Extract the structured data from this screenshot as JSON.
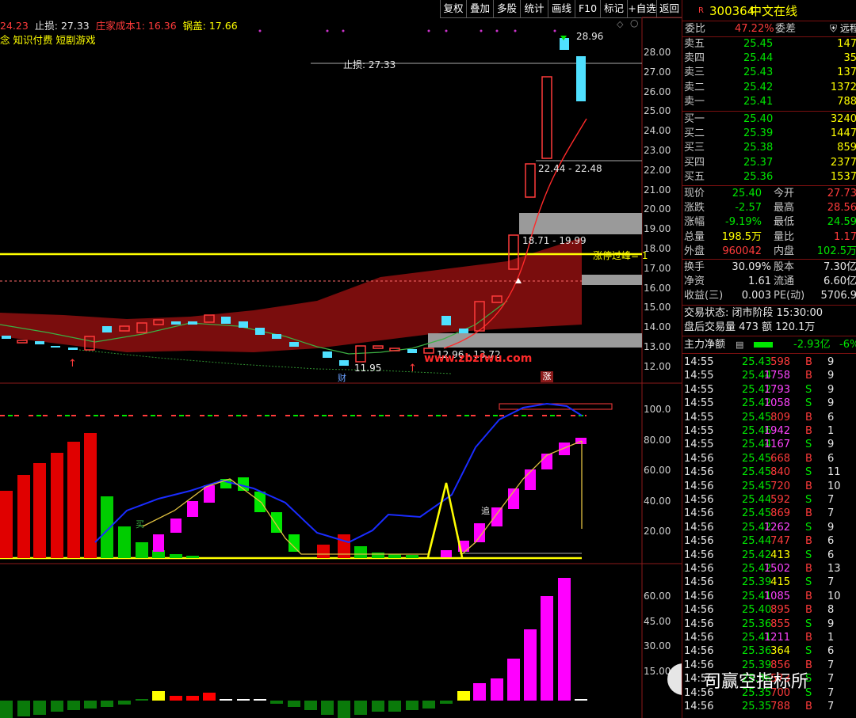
{
  "toolbar": {
    "buttons": [
      "复权",
      "叠加",
      "多股",
      "统计",
      "画线",
      "F10",
      "标记",
      "+自选",
      "返回"
    ]
  },
  "header": {
    "price_prefix": "24.23",
    "stop_loss": "止损: 27.33",
    "cost": "庄家成本1: 16.36",
    "lid": "锅盖: 17.66",
    "concepts": "念 知识付费 短剧游戏"
  },
  "y_axis": [
    "28.00",
    "27.00",
    "26.00",
    "25.00",
    "24.00",
    "23.00",
    "22.00",
    "21.00",
    "20.00",
    "19.00",
    "18.00",
    "17.00",
    "16.00",
    "15.00",
    "14.00",
    "13.00",
    "12.00"
  ],
  "sub1_axis": [
    "100.0",
    "80.00",
    "60.00",
    "40.00",
    "20.00"
  ],
  "sub2_axis": [
    "60.00",
    "45.00",
    "30.00",
    "15.00"
  ],
  "annotations": {
    "high": "28.96",
    "stop": "止损: 27.33",
    "range1": "22.44 - 22.48",
    "range2": "18.71 - 19.99",
    "limit_peak": "涨停过峰= 1",
    "range3": "12.96 - 13.72",
    "low": "11.95",
    "watermark": "www.zbzfwu.com",
    "cai": "财",
    "zhang": "涨",
    "buy": "买",
    "chase": "追",
    "brand": "司赢空指标所"
  },
  "stock": {
    "code": "300364",
    "name": "中文在线",
    "flag": "R"
  },
  "weibi": {
    "label1": "委比",
    "value": "47.22%",
    "label2": "委差",
    "badge": "远程"
  },
  "asks": [
    {
      "label": "卖五",
      "price": "25.45",
      "vol": "147"
    },
    {
      "label": "卖四",
      "price": "25.44",
      "vol": "35"
    },
    {
      "label": "卖三",
      "price": "25.43",
      "vol": "137"
    },
    {
      "label": "卖二",
      "price": "25.42",
      "vol": "1372"
    },
    {
      "label": "卖一",
      "price": "25.41",
      "vol": "788"
    }
  ],
  "bids": [
    {
      "label": "买一",
      "price": "25.40",
      "vol": "3240"
    },
    {
      "label": "买二",
      "price": "25.39",
      "vol": "1447"
    },
    {
      "label": "买三",
      "price": "25.38",
      "vol": "859"
    },
    {
      "label": "买四",
      "price": "25.37",
      "vol": "2377"
    },
    {
      "label": "买五",
      "price": "25.36",
      "vol": "1537"
    }
  ],
  "quote": [
    {
      "l1": "现价",
      "v1": "25.40",
      "c1": "grn",
      "l2": "今开",
      "v2": "27.73",
      "c2": "red"
    },
    {
      "l1": "涨跌",
      "v1": "-2.57",
      "c1": "grn",
      "l2": "最高",
      "v2": "28.56",
      "c2": "red"
    },
    {
      "l1": "涨幅",
      "v1": "-9.19%",
      "c1": "grn",
      "l2": "最低",
      "v2": "24.59",
      "c2": "grn"
    },
    {
      "l1": "总量",
      "v1": "198.5万",
      "c1": "yel",
      "l2": "量比",
      "v2": "1.17",
      "c2": "red"
    },
    {
      "l1": "外盘",
      "v1": "960042",
      "c1": "red",
      "l2": "内盘",
      "v2": "102.5万",
      "c2": "grn"
    }
  ],
  "stats": [
    {
      "l1": "换手",
      "v1": "30.09%",
      "l2": "股本",
      "v2": "7.30亿"
    },
    {
      "l1": "净资",
      "v1": "1.61",
      "l2": "流通",
      "v2": "6.60亿"
    },
    {
      "l1": "收益(三)",
      "v1": "0.003",
      "l2": "PE(动)",
      "v2": "5706.9"
    }
  ],
  "status": {
    "trade": "交易状态: 闭市阶段 15:30:00",
    "after": "盘后交易量 473 额 120.1万"
  },
  "capital": {
    "label": "主力净额",
    "value": "-2.93亿",
    "pct": "-6%"
  },
  "ticks": [
    {
      "t": "14:55",
      "p": "25.43",
      "v": "598",
      "d": "B",
      "n": "9"
    },
    {
      "t": "14:55",
      "p": "25.44",
      "v": "1758",
      "d": "B",
      "n": "9"
    },
    {
      "t": "14:55",
      "p": "25.42",
      "v": "1793",
      "d": "S",
      "n": "9"
    },
    {
      "t": "14:55",
      "p": "25.42",
      "v": "1058",
      "d": "S",
      "n": "9"
    },
    {
      "t": "14:55",
      "p": "25.45",
      "v": "809",
      "d": "B",
      "n": "6"
    },
    {
      "t": "14:55",
      "p": "25.46",
      "v": "1942",
      "d": "B",
      "n": "1"
    },
    {
      "t": "14:55",
      "p": "25.44",
      "v": "1167",
      "d": "S",
      "n": "9"
    },
    {
      "t": "14:56",
      "p": "25.45",
      "v": "668",
      "d": "B",
      "n": "6"
    },
    {
      "t": "14:56",
      "p": "25.45",
      "v": "840",
      "d": "S",
      "n": "11"
    },
    {
      "t": "14:56",
      "p": "25.45",
      "v": "720",
      "d": "B",
      "n": "10"
    },
    {
      "t": "14:56",
      "p": "25.44",
      "v": "592",
      "d": "S",
      "n": "7"
    },
    {
      "t": "14:56",
      "p": "25.45",
      "v": "869",
      "d": "B",
      "n": "7"
    },
    {
      "t": "14:56",
      "p": "25.42",
      "v": "1262",
      "d": "S",
      "n": "9"
    },
    {
      "t": "14:56",
      "p": "25.44",
      "v": "747",
      "d": "B",
      "n": "6"
    },
    {
      "t": "14:56",
      "p": "25.42",
      "v": "413",
      "d": "S",
      "n": "6"
    },
    {
      "t": "14:56",
      "p": "25.42",
      "v": "1502",
      "d": "B",
      "n": "13"
    },
    {
      "t": "14:56",
      "p": "25.39",
      "v": "415",
      "d": "S",
      "n": "7"
    },
    {
      "t": "14:56",
      "p": "25.41",
      "v": "1085",
      "d": "B",
      "n": "10"
    },
    {
      "t": "14:56",
      "p": "25.40",
      "v": "895",
      "d": "B",
      "n": "8"
    },
    {
      "t": "14:56",
      "p": "25.36",
      "v": "855",
      "d": "S",
      "n": "9"
    },
    {
      "t": "14:56",
      "p": "25.41",
      "v": "1211",
      "d": "B",
      "n": "1"
    },
    {
      "t": "14:56",
      "p": "25.36",
      "v": "364",
      "d": "S",
      "n": "6"
    },
    {
      "t": "14:56",
      "p": "25.39",
      "v": "856",
      "d": "B",
      "n": "7"
    },
    {
      "t": "14:56",
      "p": "25.36",
      "v": "573",
      "d": "S",
      "n": "7"
    },
    {
      "t": "14:56",
      "p": "25.35",
      "v": "700",
      "d": "S",
      "n": "7"
    },
    {
      "t": "14:56",
      "p": "25.35",
      "v": "788",
      "d": "B",
      "n": "7"
    }
  ],
  "colors": {
    "up": "#ff3b3b",
    "down": "#00e600",
    "candle_up": "#ff3b3b",
    "candle_down": "#4fe0ff",
    "magenta": "#ff00ff",
    "yellow": "#ffff00"
  }
}
